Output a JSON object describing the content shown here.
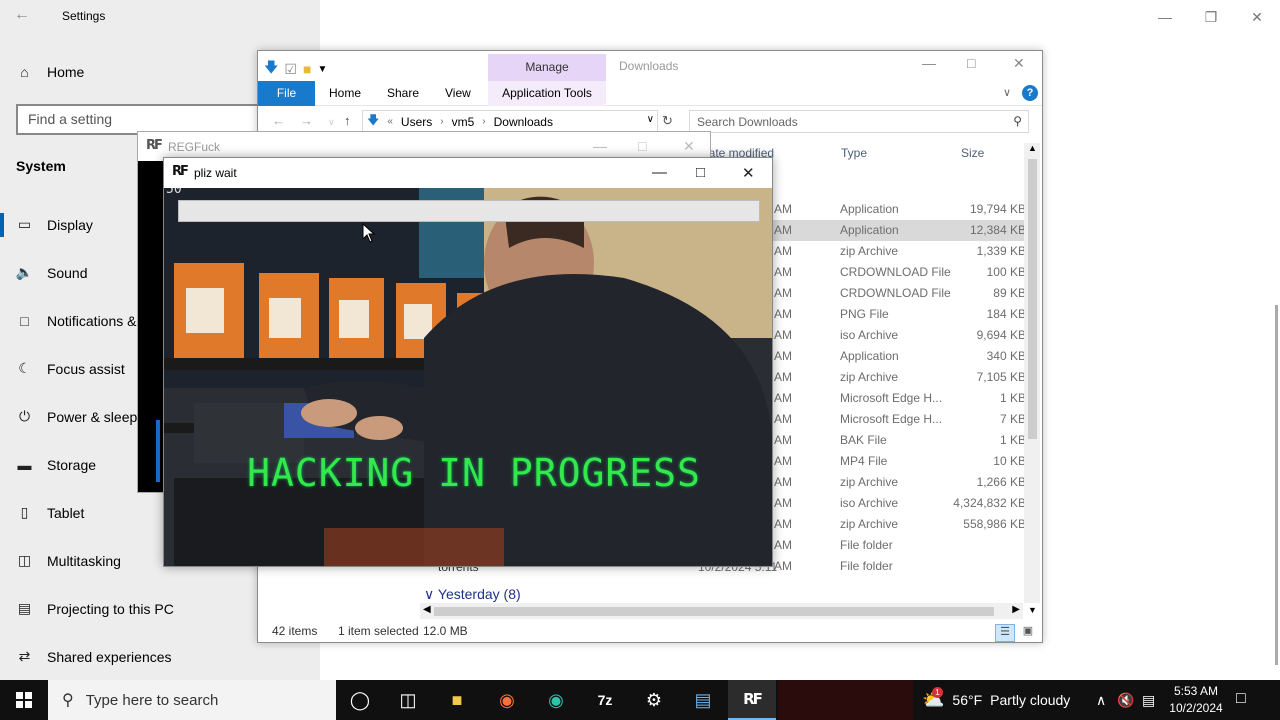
{
  "settings": {
    "title": "Settings",
    "home_label": "Home",
    "search_placeholder": "Find a setting",
    "section": "System",
    "items": [
      {
        "label": "Display",
        "icon": "monitor-icon"
      },
      {
        "label": "Sound",
        "icon": "speaker-icon"
      },
      {
        "label": "Notifications & actions",
        "icon": "notifications-icon"
      },
      {
        "label": "Focus assist",
        "icon": "moon-icon"
      },
      {
        "label": "Power & sleep",
        "icon": "power-icon"
      },
      {
        "label": "Storage",
        "icon": "storage-icon"
      },
      {
        "label": "Tablet",
        "icon": "tablet-icon"
      },
      {
        "label": "Multitasking",
        "icon": "multitasking-icon"
      },
      {
        "label": "Projecting to this PC",
        "icon": "projector-icon"
      },
      {
        "label": "Shared experiences",
        "icon": "shared-experiences-icon"
      }
    ],
    "selected_item": "Display"
  },
  "explorer": {
    "title": "Downloads",
    "manage_tab": "Manage",
    "ribbon_tabs": {
      "file": "File",
      "home": "Home",
      "share": "Share",
      "view": "View",
      "tools": "Application Tools"
    },
    "breadcrumb": {
      "prefix": "«",
      "parts": [
        "Users",
        "vm5",
        "Downloads"
      ]
    },
    "search_placeholder": "Search Downloads",
    "columns": {
      "date": "Date modified",
      "type": "Type",
      "size": "Size"
    },
    "rows": [
      {
        "time": "AM",
        "type": "Application",
        "size": "19,794 KB",
        "selected": false
      },
      {
        "time": "AM",
        "type": "Application",
        "size": "12,384 KB",
        "selected": true
      },
      {
        "time": "AM",
        "type": "zip Archive",
        "size": "1,339 KB",
        "selected": false
      },
      {
        "time": "AM",
        "type": "CRDOWNLOAD File",
        "size": "100 KB",
        "selected": false
      },
      {
        "time": "AM",
        "type": "CRDOWNLOAD File",
        "size": "89 KB",
        "selected": false
      },
      {
        "time": "AM",
        "type": "PNG File",
        "size": "184 KB",
        "selected": false
      },
      {
        "time": "AM",
        "type": "iso Archive",
        "size": "9,694 KB",
        "selected": false
      },
      {
        "time": "AM",
        "type": "Application",
        "size": "340 KB",
        "selected": false
      },
      {
        "time": "AM",
        "type": "zip Archive",
        "size": "7,105 KB",
        "selected": false
      },
      {
        "time": "AM",
        "type": "Microsoft Edge H...",
        "size": "1 KB",
        "selected": false
      },
      {
        "time": "AM",
        "type": "Microsoft Edge H...",
        "size": "7 KB",
        "selected": false
      },
      {
        "time": "AM",
        "type": "BAK File",
        "size": "1 KB",
        "selected": false
      },
      {
        "time": "AM",
        "type": "MP4 File",
        "size": "10 KB",
        "selected": false
      },
      {
        "time": "AM",
        "type": "zip Archive",
        "size": "1,266 KB",
        "selected": false
      },
      {
        "time": "AM",
        "type": "iso Archive",
        "size": "4,324,832 KB",
        "selected": false
      },
      {
        "time": "AM",
        "type": "zip Archive",
        "size": "558,986 KB",
        "selected": false
      },
      {
        "time": "AM",
        "type": "File folder",
        "size": "",
        "selected": false
      },
      {
        "time": "AM",
        "type": "File folder",
        "size": "",
        "selected": false
      }
    ],
    "torrents_name": "torrents",
    "torrents_date": "10/2/2024 5:11",
    "group_header": "Yesterday (8)",
    "status": {
      "items": "42 items",
      "selected": "1 item selected",
      "size": "12.0 MB"
    }
  },
  "regfuck": {
    "title": "REGFuck"
  },
  "pliz": {
    "title": "pliz wait",
    "corner_text": "50",
    "overlay_text": "HACKING IN PROGRESS"
  },
  "taskbar": {
    "search_placeholder": "Type here to search",
    "apps": [
      "task-view-icon",
      "cortana-icon",
      "file-explorer-icon",
      "firefox-icon",
      "edge-icon",
      "7zip-icon",
      "settings-icon",
      "notepad-icon",
      "regfuck-icon"
    ],
    "weather_temp": "56°F",
    "weather_desc": "Partly cloudy",
    "weather_badge": "1",
    "time": "5:53 AM",
    "date": "10/2/2024"
  },
  "colors": {
    "accent": "#0063b1",
    "file_tab": "#1979ca",
    "manage_tab": "#e6d5f7",
    "hacking_text": "#35e84a"
  }
}
